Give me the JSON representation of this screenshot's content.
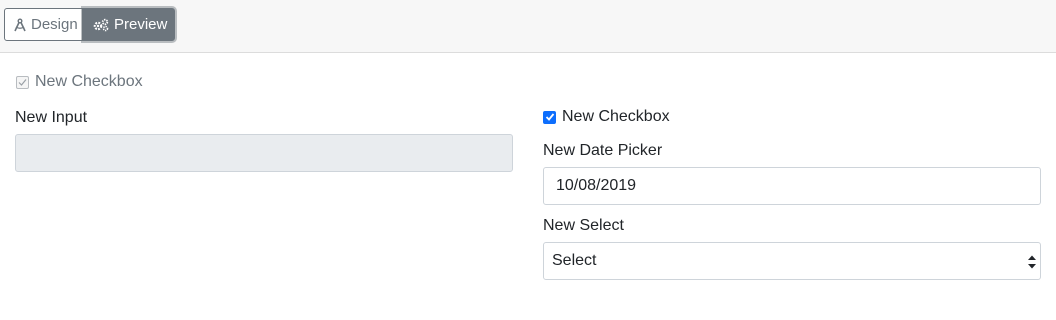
{
  "toolbar": {
    "design_label": "Design",
    "preview_label": "Preview",
    "design_icon": "compass-drafting-icon",
    "preview_icon": "cogs-icon"
  },
  "form": {
    "top_checkbox": {
      "label": "New Checkbox",
      "checked": true,
      "disabled": true
    },
    "input": {
      "label": "New Input",
      "value": ""
    },
    "right_checkbox": {
      "label": "New Checkbox",
      "checked": true
    },
    "date_picker": {
      "label": "New Date Picker",
      "value": "10/08/2019"
    },
    "select": {
      "label": "New Select",
      "value": "Select"
    }
  },
  "colors": {
    "accent": "#0d6efd",
    "secondary": "#6c757d",
    "disabled_bg": "#e9ecef"
  }
}
